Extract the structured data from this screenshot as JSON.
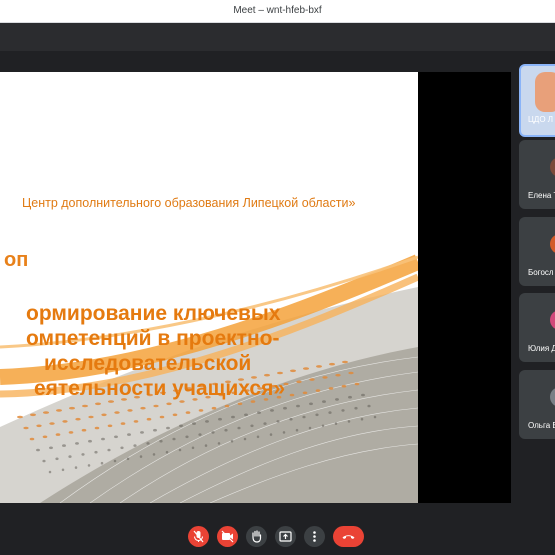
{
  "window": {
    "title": "Meet – wnt-hfeb-bxf"
  },
  "slide": {
    "org": "Центр дополнительного образования Липецкой области»",
    "kind": "оп",
    "topic_lines": [
      "ормирование ключевых",
      "омпетенций в проектно-",
      "исследовательской",
      "еятельности учащихся»"
    ]
  },
  "participants": [
    {
      "name": "ЦДО Л",
      "self": true
    },
    {
      "name": "Елена Т",
      "avatar_color": "#7b4a3a"
    },
    {
      "name": "Богосл",
      "avatar_color": "#d35b2a"
    },
    {
      "name": "Юлия Д",
      "avatar_color": "#d1497a"
    },
    {
      "name": "Ольга Е",
      "avatar_color": "#7a7f86"
    }
  ],
  "controls": {
    "mic": "mic-off",
    "camera": "camera-off",
    "raise_hand": "raise-hand",
    "present": "present-screen",
    "more": "more-options",
    "end": "end-call"
  },
  "colors": {
    "accent": "#e8811a",
    "danger": "#ea4335",
    "background": "#202124"
  }
}
